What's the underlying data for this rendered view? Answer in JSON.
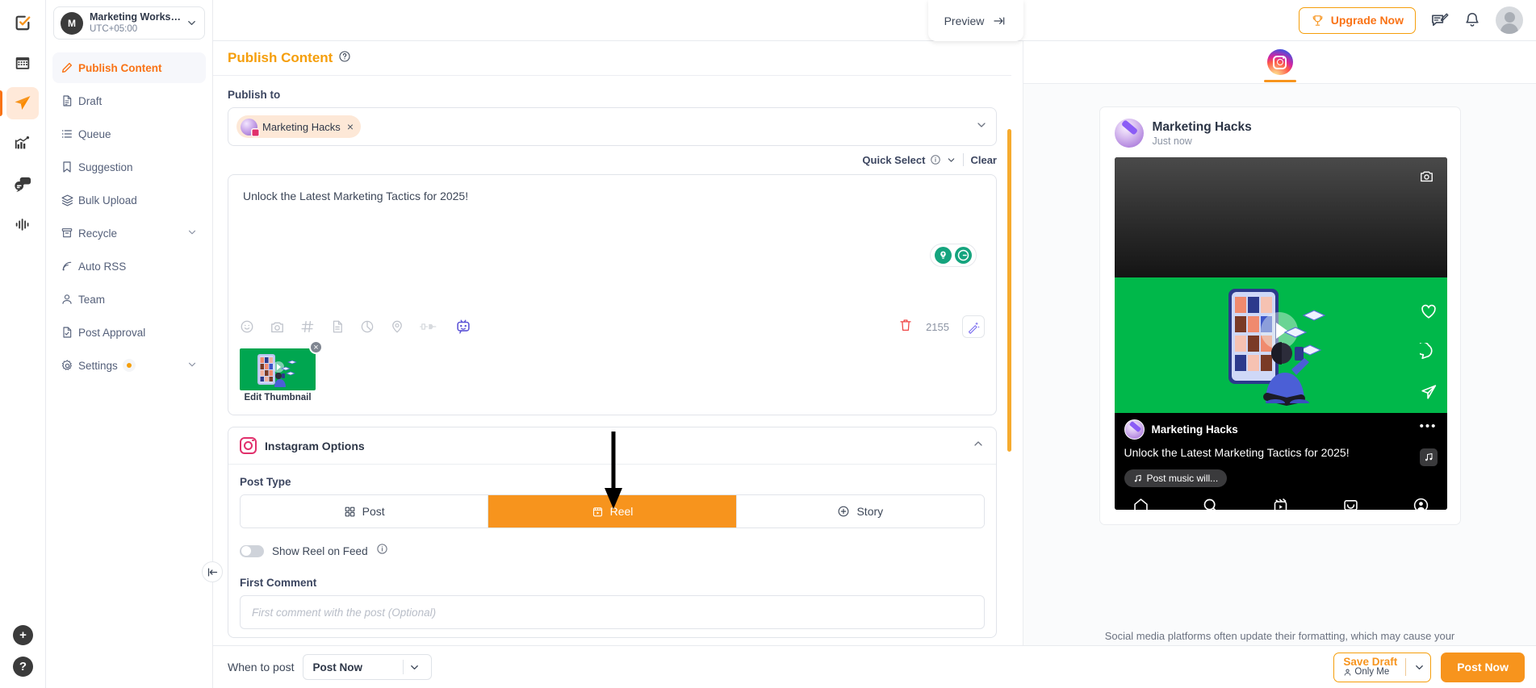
{
  "workspace": {
    "avatar_initial": "M",
    "name": "Marketing Workspa...",
    "timezone": "UTC+05:00"
  },
  "rail": {
    "items": [
      {
        "name": "tasks-icon",
        "label": "Tasks"
      },
      {
        "name": "calendar-icon",
        "label": "Calendar"
      },
      {
        "name": "publish-icon",
        "label": "Publish"
      },
      {
        "name": "analytics-icon",
        "label": "Analytics"
      },
      {
        "name": "engage-icon",
        "label": "Engage"
      },
      {
        "name": "listening-icon",
        "label": "Listening"
      }
    ],
    "add_label": "+",
    "help_label": "?"
  },
  "sidebar": {
    "items": [
      {
        "label": "Publish Content",
        "icon": "pencil-icon",
        "active": true
      },
      {
        "label": "Draft",
        "icon": "document-icon",
        "active": false
      },
      {
        "label": "Queue",
        "icon": "list-icon",
        "active": false
      },
      {
        "label": "Suggestion",
        "icon": "bookmark-icon",
        "active": false
      },
      {
        "label": "Bulk Upload",
        "icon": "layers-icon",
        "active": false
      },
      {
        "label": "Recycle",
        "icon": "archive-icon",
        "active": false,
        "chevron": true
      },
      {
        "label": "Auto RSS",
        "icon": "rss-icon",
        "active": false
      },
      {
        "label": "Team",
        "icon": "user-icon",
        "active": false
      },
      {
        "label": "Post Approval",
        "icon": "doc-check-icon",
        "active": false
      },
      {
        "label": "Settings",
        "icon": "gear-icon",
        "active": false,
        "chevron": true,
        "badge": true
      }
    ]
  },
  "topbar": {
    "upgrade_label": "Upgrade Now",
    "icons": [
      "feedback-icon",
      "bell-icon",
      "avatar"
    ]
  },
  "page": {
    "title": "Publish Content",
    "help_icon": "question-circle-icon"
  },
  "publish_to": {
    "label": "Publish to",
    "chips": [
      {
        "name": "Marketing Hacks",
        "network": "instagram",
        "remove": "×"
      }
    ],
    "quick_select_label": "Quick Select",
    "clear_label": "Clear"
  },
  "editor": {
    "content": "Unlock the Latest Marketing Tactics for 2025!",
    "char_count": "2155",
    "tools": [
      "emoji-icon",
      "camera-icon",
      "hashtag-icon",
      "document-icon",
      "chart-icon",
      "location-icon",
      "plug-icon",
      "ai-bot-icon"
    ],
    "right_tools": [
      "trash-icon",
      "magic-wand-icon"
    ],
    "assistant_icons": [
      "lightbulb-icon",
      "grammarly-icon"
    ]
  },
  "media": {
    "edit_thumbnail_label": "Edit Thumbnail",
    "remove_label": "×"
  },
  "instagram_options": {
    "title": "Instagram Options",
    "collapse_icon": "chevron-up-icon",
    "post_type_label": "Post Type",
    "post_types": [
      {
        "label": "Post",
        "icon": "grid-icon",
        "active": false
      },
      {
        "label": "Reel",
        "icon": "reel-icon",
        "active": true
      },
      {
        "label": "Story",
        "icon": "plus-circle-icon",
        "active": false
      }
    ],
    "show_reel_label": "Show Reel on Feed",
    "show_reel_on": false,
    "first_comment_label": "First Comment",
    "first_comment_placeholder": "First comment with the post (Optional)",
    "first_comment_value": ""
  },
  "bottom_bar": {
    "when_to_post_label": "When to post",
    "schedule_value": "Post Now",
    "save_draft_label": "Save Draft",
    "save_draft_sub": "Only Me",
    "post_now_label": "Post Now"
  },
  "preview": {
    "tab_label": "Preview",
    "tab_icon": "arrow-right-to-line-icon",
    "network_tab": "instagram",
    "account_name": "Marketing Hacks",
    "timestamp": "Just now",
    "caption": "Unlock the Latest Marketing Tactics for 2025!",
    "music_label": "Post music will...",
    "nav_icons": [
      "home-icon",
      "search-icon",
      "reels-icon",
      "shop-icon",
      "profile-icon"
    ],
    "side_icons": [
      "heart-icon",
      "comment-icon",
      "share-icon",
      "more-icon",
      "music-icon"
    ],
    "note": "Social media platforms often update their formatting, which may cause your"
  },
  "colors": {
    "accent": "#f7941d",
    "accent_border": "#f59e0b",
    "instagram": "#e1306c",
    "thumb_green": "#00a650",
    "preview_green": "#00b84a",
    "text": "#3d4758"
  }
}
